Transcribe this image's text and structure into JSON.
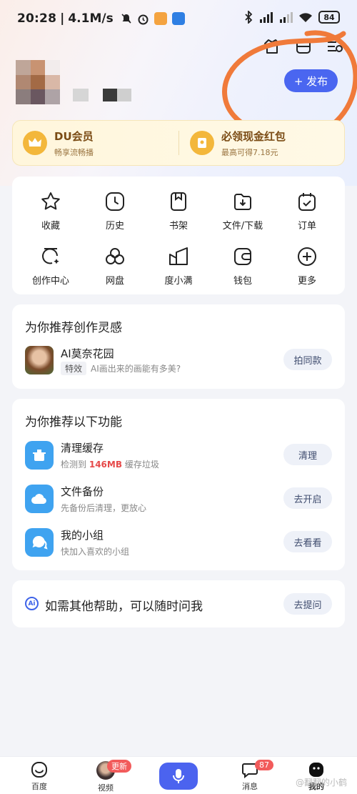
{
  "status_bar": {
    "time": "20:28",
    "network_speed": "4.1M/s",
    "battery": "84",
    "icons": [
      "mute-icon",
      "alarm-icon",
      "app-notification-icon",
      "app-notification-icon",
      "bluetooth-icon",
      "hd-signal-icon",
      "hd-signal-icon",
      "wifi-icon",
      "battery-icon"
    ]
  },
  "header": {
    "icons": [
      "shirt-icon",
      "scan-icon",
      "settings-icon"
    ],
    "publish_label": "+ 发布"
  },
  "vip": {
    "member_title": "DU会员",
    "member_sub": "畅享流畅播",
    "reward_title": "必领现金红包",
    "reward_sub": "最高可得7.18元"
  },
  "grid": {
    "items": [
      {
        "label": "收藏",
        "icon": "star-icon"
      },
      {
        "label": "历史",
        "icon": "clock-icon"
      },
      {
        "label": "书架",
        "icon": "bookshelf-icon"
      },
      {
        "label": "文件/下载",
        "icon": "download-icon"
      },
      {
        "label": "订单",
        "icon": "order-icon"
      },
      {
        "label": "创作中心",
        "icon": "creation-icon"
      },
      {
        "label": "网盘",
        "icon": "cloud-drive-icon"
      },
      {
        "label": "度小满",
        "icon": "duxiaoman-icon"
      },
      {
        "label": "钱包",
        "icon": "wallet-icon"
      },
      {
        "label": "更多",
        "icon": "plus-circle-icon"
      }
    ]
  },
  "inspiration": {
    "title": "为你推荐创作灵感",
    "item_title": "AI莫奈花园",
    "item_tag": "特效",
    "item_desc": "AI画出来的画能有多美?",
    "action": "拍同款"
  },
  "recommend": {
    "title": "为你推荐以下功能",
    "items": [
      {
        "title": "清理缓存",
        "sub_pre": "检测到",
        "sub_hl": "146MB",
        "sub_post": "缓存垃圾",
        "action": "清理",
        "icon": "clean-icon"
      },
      {
        "title": "文件备份",
        "sub": "先备份后清理，更放心",
        "action": "去开启",
        "icon": "cloud-backup-icon"
      },
      {
        "title": "我的小组",
        "sub": "快加入喜欢的小组",
        "action": "去看看",
        "icon": "group-chat-icon"
      }
    ]
  },
  "help": {
    "text": "如需其他帮助，可以随时问我",
    "action": "去提问"
  },
  "tabbar": {
    "tabs": [
      {
        "label": "百度",
        "icon": "baidu-home-icon"
      },
      {
        "label": "视频",
        "icon": "video-avatar-icon",
        "badge": "更新"
      },
      {
        "label": "",
        "icon": "mic-icon"
      },
      {
        "label": "消息",
        "icon": "message-icon",
        "badge": "87"
      },
      {
        "label": "我的",
        "icon": "profile-icon"
      }
    ],
    "watermark": "@翻翻的小鹤"
  },
  "colors": {
    "accent": "#4a66f0",
    "gold": "#f3b73b",
    "badge_red": "#f25b5b",
    "annotation_orange": "#f07a3a"
  }
}
